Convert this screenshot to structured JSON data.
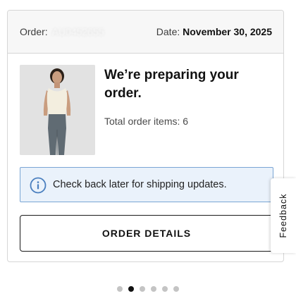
{
  "order": {
    "label": "Order:",
    "number": "AU0452655",
    "date_label": "Date:",
    "date_value": "November 30, 2025"
  },
  "status": {
    "title": "We’re preparing your order.",
    "items_text": "Total order items: 6"
  },
  "info_banner": {
    "icon": "info-icon",
    "text": "Check back later for shipping updates."
  },
  "actions": {
    "order_details_label": "ORDER DETAILS"
  },
  "feedback": {
    "label": "Feedback"
  },
  "pager": {
    "count": 6,
    "active_index": 1
  },
  "colors": {
    "banner_background": "#eaf2fb",
    "banner_border": "#7aa5d4",
    "info_icon": "#4a7fbf",
    "pager_active": "#111111",
    "pager_inactive": "#c4c4c4"
  }
}
